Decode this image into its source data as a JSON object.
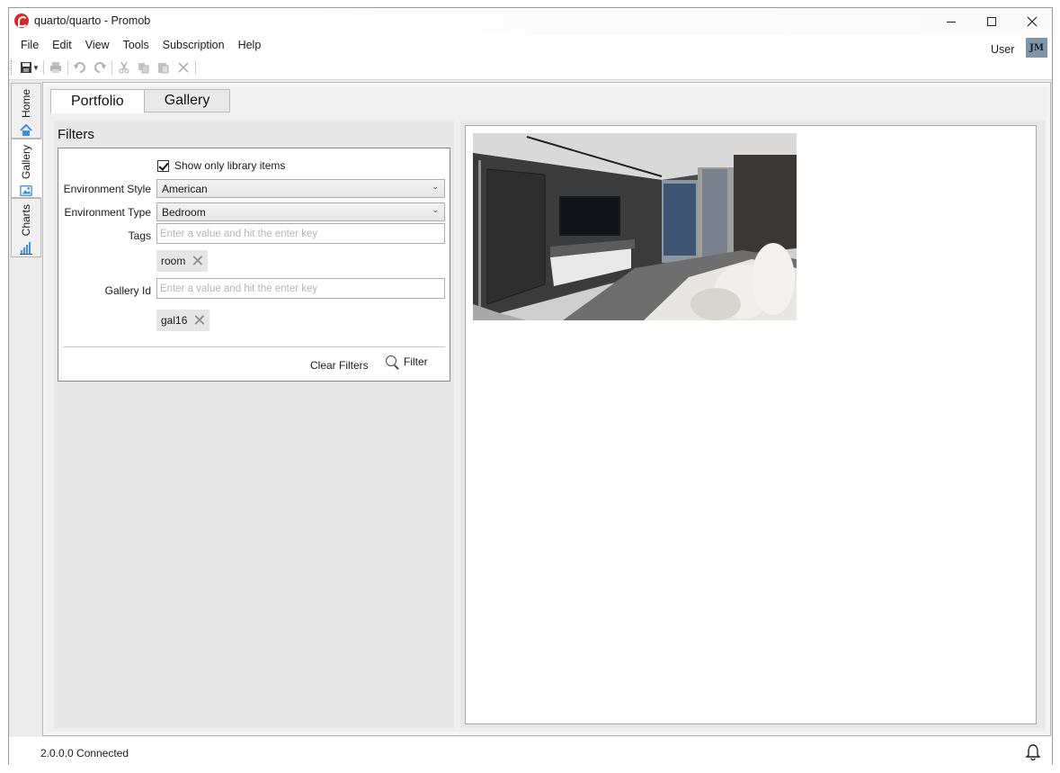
{
  "window": {
    "title": "quarto/quarto - Promob"
  },
  "menu": {
    "items": [
      "File",
      "Edit",
      "View",
      "Tools",
      "Subscription",
      "Help"
    ]
  },
  "user": {
    "label": "User",
    "initials": "JM"
  },
  "side_tabs": [
    {
      "label": "Home",
      "icon": "home-icon"
    },
    {
      "label": "Gallery",
      "icon": "gallery-icon"
    },
    {
      "label": "Charts",
      "icon": "charts-icon"
    }
  ],
  "main_tabs": [
    {
      "label": "Portfolio",
      "selected": true
    },
    {
      "label": "Gallery",
      "selected": false
    }
  ],
  "filters": {
    "title": "Filters",
    "show_only_library_label": "Show only library items",
    "show_only_library_checked": true,
    "env_style_label": "Environment Style",
    "env_style_value": "American",
    "env_type_label": "Environment Type",
    "env_type_value": "Bedroom",
    "tags_label": "Tags",
    "tags_placeholder": "Enter a value and hit the enter key",
    "tags": [
      "room"
    ],
    "gallery_id_label": "Gallery Id",
    "gallery_id_placeholder": "Enter a value and hit the enter key",
    "gallery_ids": [
      "gal16"
    ],
    "clear_label": "Clear Filters",
    "filter_label": "Filter"
  },
  "status": {
    "text": "2.0.0.0  Connected"
  },
  "colors": {
    "accent": "#2f7fd6",
    "logo": "#d9262b"
  }
}
